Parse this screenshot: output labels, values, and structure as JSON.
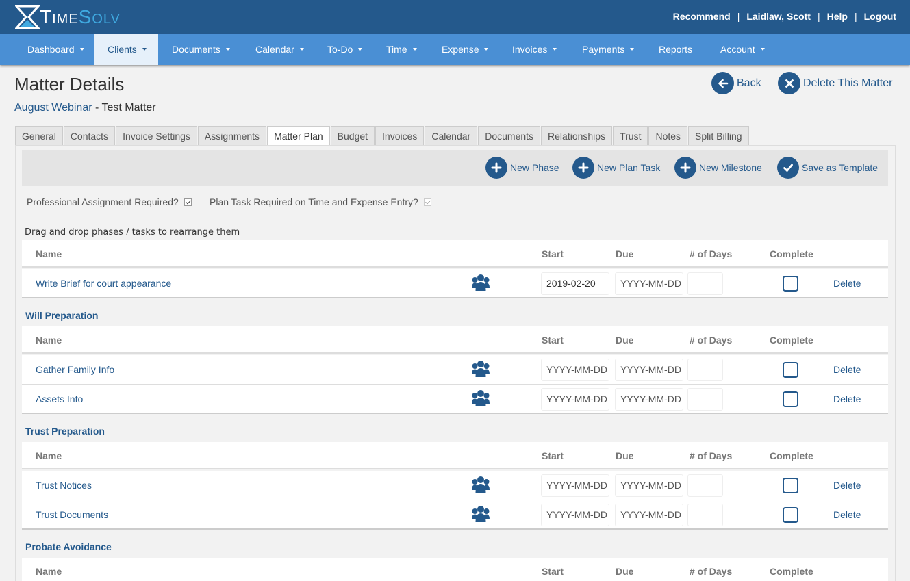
{
  "brand": {
    "time": "Time",
    "solv": "Solv"
  },
  "toplinks": [
    "Recommend",
    "Laidlaw, Scott",
    "Help",
    "Logout"
  ],
  "nav": [
    {
      "label": "Dashboard",
      "caret": true
    },
    {
      "label": "Clients",
      "caret": true,
      "active": true
    },
    {
      "label": "Documents",
      "caret": true
    },
    {
      "label": "Calendar",
      "caret": true
    },
    {
      "label": "To-Do",
      "caret": true
    },
    {
      "label": "Time",
      "caret": true
    },
    {
      "label": "Expense",
      "caret": true
    },
    {
      "label": "Invoices",
      "caret": true
    },
    {
      "label": "Payments",
      "caret": true
    },
    {
      "label": "Reports",
      "caret": false
    },
    {
      "label": "Account",
      "caret": true
    }
  ],
  "page": {
    "title": "Matter Details",
    "client": "August Webinar",
    "matter_sep": " - ",
    "matter": "Test Matter",
    "back_label": "Back",
    "delete_matter_label": "Delete This Matter"
  },
  "tabs": [
    "General",
    "Contacts",
    "Invoice Settings",
    "Assignments",
    "Matter Plan",
    "Budget",
    "Invoices",
    "Calendar",
    "Documents",
    "Relationships",
    "Trust",
    "Notes",
    "Split Billing"
  ],
  "active_tab": "Matter Plan",
  "toolbar": {
    "new_phase": "New Phase",
    "new_plan_task": "New Plan Task",
    "new_milestone": "New Milestone",
    "save_template": "Save as Template"
  },
  "options": {
    "prof_assign_label": "Professional Assignment Required?",
    "prof_assign_checked": true,
    "plan_task_label": "Plan Task Required on Time and Expense Entry?",
    "plan_task_checked": true
  },
  "hint": "Drag and drop phases / tasks to rearrange them",
  "columns": {
    "name": "Name",
    "start": "Start",
    "due": "Due",
    "days": "# of Days",
    "complete": "Complete"
  },
  "delete_label": "Delete",
  "date_placeholder": "YYYY-MM-DD",
  "top_tasks": [
    {
      "name": "Write Brief for court appearance",
      "start": "2019-02-20",
      "due": ""
    }
  ],
  "phases": [
    {
      "name": "Will Preparation",
      "tasks": [
        {
          "name": "Gather Family Info"
        },
        {
          "name": "Assets Info"
        }
      ]
    },
    {
      "name": "Trust Preparation",
      "tasks": [
        {
          "name": "Trust Notices"
        },
        {
          "name": "Trust Documents"
        }
      ]
    },
    {
      "name": "Probate Avoidance",
      "tasks": []
    }
  ],
  "colors": {
    "primary": "#24598c",
    "nav": "#4a8fd4",
    "logo_accent": "#3fa9e0"
  }
}
